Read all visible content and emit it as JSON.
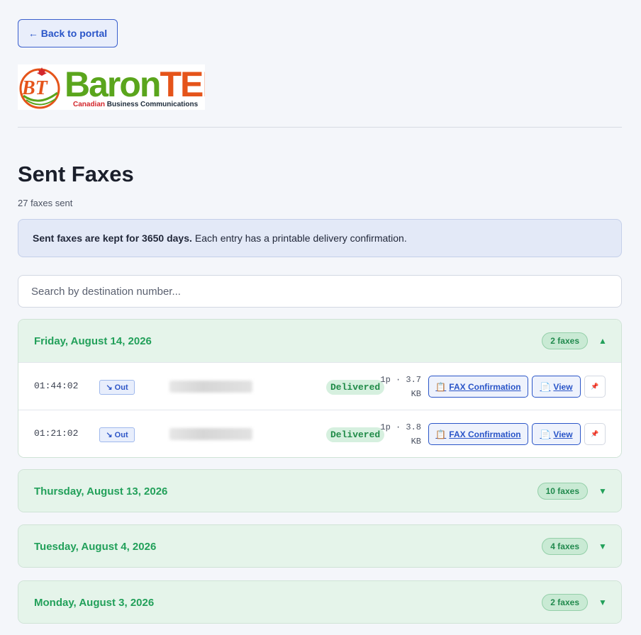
{
  "nav": {
    "back_label": "← Back to portal"
  },
  "logo": {
    "name_part1": "Baron",
    "name_part2": "TEL",
    "monogram": "BT",
    "tagline_part1": "Canadian",
    "tagline_part2": "Business Communications"
  },
  "page": {
    "title": "Sent Faxes",
    "count": "27 faxes sent"
  },
  "notice": {
    "bold": "Sent faxes are kept for 3650 days.",
    "rest": "Each entry has a printable delivery confirmation."
  },
  "search": {
    "placeholder": "Search by destination number..."
  },
  "groups": [
    {
      "date": "Friday, August 14, 2026",
      "badge": "2 faxes",
      "caret": "▲",
      "expanded": true,
      "rows": [
        {
          "time": "01:44:02",
          "direction": "↘ Out",
          "status": "Delivered",
          "pages": "1p · 3.7",
          "size_unit": "KB",
          "confirm_label": "FAX Confirmation",
          "view_label": "View"
        },
        {
          "time": "01:21:02",
          "direction": "↘ Out",
          "status": "Delivered",
          "pages": "1p · 3.8",
          "size_unit": "KB",
          "confirm_label": "FAX Confirmation",
          "view_label": "View"
        }
      ]
    },
    {
      "date": "Thursday, August 13, 2026",
      "badge": "10 faxes",
      "caret": "▼",
      "expanded": false
    },
    {
      "date": "Tuesday, August 4, 2026",
      "badge": "4 faxes",
      "caret": "▼",
      "expanded": false
    },
    {
      "date": "Monday, August 3, 2026",
      "badge": "2 faxes",
      "caret": "▼",
      "expanded": false
    }
  ],
  "icons": {
    "confirm": "clipboard-icon",
    "view": "document-icon",
    "pin": "pin-icon"
  },
  "colors": {
    "accent": "#2a55c8",
    "success": "#22a05a",
    "group_bg": "#e5f4ea"
  }
}
